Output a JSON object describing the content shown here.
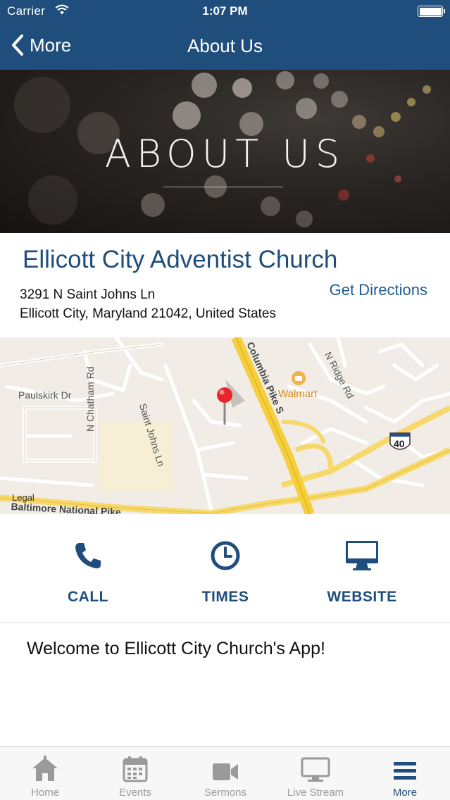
{
  "status_bar": {
    "carrier": "Carrier",
    "time": "1:07 PM"
  },
  "navbar": {
    "back_label": "More",
    "title": "About Us"
  },
  "hero": {
    "title": "ABOUT US"
  },
  "church": {
    "name": "Ellicott City Adventist Church",
    "address_line1": "3291 N Saint Johns Ln",
    "address_line2": "Ellicott City, Maryland 21042, United States",
    "directions_label": "Get Directions"
  },
  "map": {
    "labels": {
      "paulskirk": "Paulskirk Dr",
      "saint_johns": "Saint Johns Ln",
      "columbia": "Columbia Pike S",
      "walmart": "Walmart",
      "ridge": "N Ridge Rd",
      "chatham": "N Chatham Rd",
      "baltimore": "Baltimore National Pike",
      "route": "40"
    },
    "legal": "Legal"
  },
  "actions": {
    "call": "CALL",
    "times": "TIMES",
    "website": "WEBSITE"
  },
  "welcome": "Welcome to Ellicott City Church's App!",
  "tabs": [
    {
      "label": "Home",
      "icon": "home-icon"
    },
    {
      "label": "Events",
      "icon": "calendar-icon"
    },
    {
      "label": "Sermons",
      "icon": "video-icon"
    },
    {
      "label": "Live Stream",
      "icon": "monitor-icon"
    },
    {
      "label": "More",
      "icon": "menu-icon"
    }
  ],
  "colors": {
    "brand": "#1f4e7d",
    "accent": "#1f5d8d",
    "tab_inactive": "#9a9a9a"
  }
}
